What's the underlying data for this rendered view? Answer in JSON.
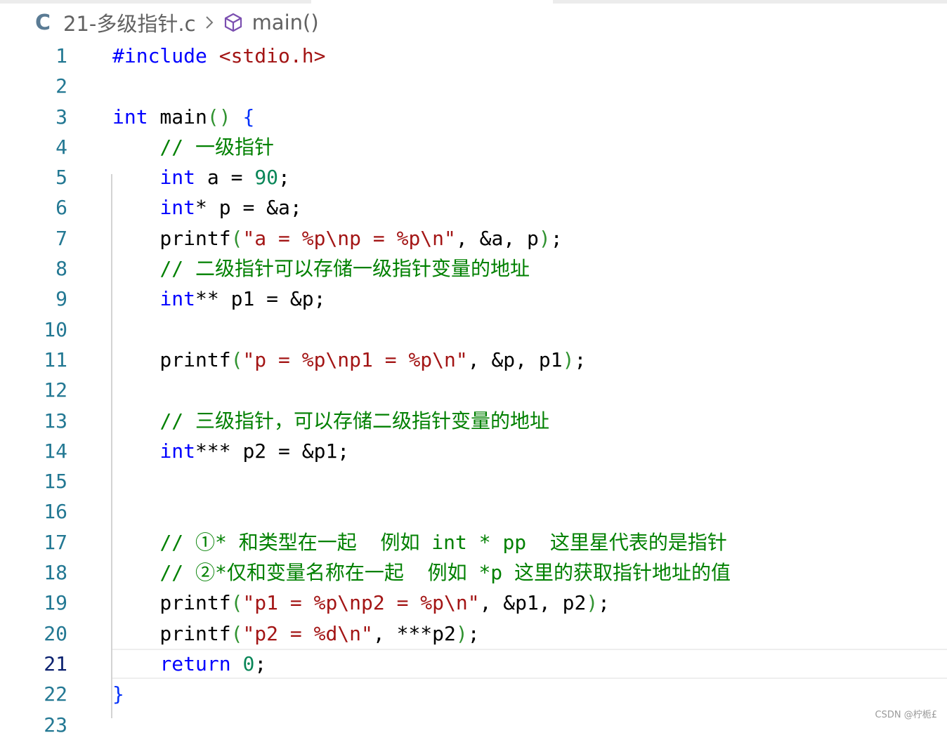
{
  "breadcrumb": {
    "lang_icon": "C",
    "file": "21-多级指针.c",
    "symbol": "main()",
    "separator_icon": "chevron-right-icon",
    "symbol_icon": "cube-icon"
  },
  "editor": {
    "active_line": 21,
    "lines": [
      {
        "n": "1",
        "tokens": [
          {
            "t": "#include ",
            "c": "kw"
          },
          {
            "t": "<stdio.h>",
            "c": "str"
          }
        ]
      },
      {
        "n": "2",
        "tokens": []
      },
      {
        "n": "3",
        "tokens": [
          {
            "t": "int",
            "c": "kw"
          },
          {
            "t": " main",
            "c": ""
          },
          {
            "t": "()",
            "c": "br2"
          },
          {
            "t": " ",
            "c": ""
          },
          {
            "t": "{",
            "c": "br1"
          }
        ]
      },
      {
        "n": "4",
        "tokens": [
          {
            "t": "    ",
            "c": ""
          },
          {
            "t": "// 一级指针",
            "c": "cm"
          }
        ]
      },
      {
        "n": "5",
        "tokens": [
          {
            "t": "    ",
            "c": ""
          },
          {
            "t": "int",
            "c": "kw"
          },
          {
            "t": " a = ",
            "c": ""
          },
          {
            "t": "90",
            "c": "num"
          },
          {
            "t": ";",
            "c": ""
          }
        ]
      },
      {
        "n": "6",
        "tokens": [
          {
            "t": "    ",
            "c": ""
          },
          {
            "t": "int",
            "c": "kw"
          },
          {
            "t": "* p = &a;",
            "c": ""
          }
        ]
      },
      {
        "n": "7",
        "tokens": [
          {
            "t": "    printf",
            "c": ""
          },
          {
            "t": "(",
            "c": "br2"
          },
          {
            "t": "\"a = %p\\np = %p\\n\"",
            "c": "str"
          },
          {
            "t": ", &a, p",
            "c": ""
          },
          {
            "t": ")",
            "c": "br2"
          },
          {
            "t": ";",
            "c": ""
          }
        ]
      },
      {
        "n": "8",
        "tokens": [
          {
            "t": "    ",
            "c": ""
          },
          {
            "t": "// 二级指针可以存储一级指针变量的地址",
            "c": "cm"
          }
        ]
      },
      {
        "n": "9",
        "tokens": [
          {
            "t": "    ",
            "c": ""
          },
          {
            "t": "int",
            "c": "kw"
          },
          {
            "t": "** p1 = &p;",
            "c": ""
          }
        ]
      },
      {
        "n": "10",
        "tokens": []
      },
      {
        "n": "11",
        "tokens": [
          {
            "t": "    printf",
            "c": ""
          },
          {
            "t": "(",
            "c": "br2"
          },
          {
            "t": "\"p = %p\\np1 = %p\\n\"",
            "c": "str"
          },
          {
            "t": ", &p, p1",
            "c": ""
          },
          {
            "t": ")",
            "c": "br2"
          },
          {
            "t": ";",
            "c": ""
          }
        ]
      },
      {
        "n": "12",
        "tokens": []
      },
      {
        "n": "13",
        "tokens": [
          {
            "t": "    ",
            "c": ""
          },
          {
            "t": "// 三级指针，可以存储二级指针变量的地址",
            "c": "cm"
          }
        ]
      },
      {
        "n": "14",
        "tokens": [
          {
            "t": "    ",
            "c": ""
          },
          {
            "t": "int",
            "c": "kw"
          },
          {
            "t": "*** p2 = &p1;",
            "c": ""
          }
        ]
      },
      {
        "n": "15",
        "tokens": []
      },
      {
        "n": "16",
        "tokens": []
      },
      {
        "n": "17",
        "tokens": [
          {
            "t": "    ",
            "c": ""
          },
          {
            "t": "// ①* 和类型在一起  例如 int * pp  这里星代表的是指针",
            "c": "cm"
          }
        ]
      },
      {
        "n": "18",
        "tokens": [
          {
            "t": "    ",
            "c": ""
          },
          {
            "t": "// ②*仅和变量名称在一起  例如 *p 这里的获取指针地址的值",
            "c": "cm"
          }
        ]
      },
      {
        "n": "19",
        "tokens": [
          {
            "t": "    printf",
            "c": ""
          },
          {
            "t": "(",
            "c": "br2"
          },
          {
            "t": "\"p1 = %p\\np2 = %p\\n\"",
            "c": "str"
          },
          {
            "t": ", &p1, p2",
            "c": ""
          },
          {
            "t": ")",
            "c": "br2"
          },
          {
            "t": ";",
            "c": ""
          }
        ]
      },
      {
        "n": "20",
        "tokens": [
          {
            "t": "    printf",
            "c": ""
          },
          {
            "t": "(",
            "c": "br2"
          },
          {
            "t": "\"p2 = %d\\n\"",
            "c": "str"
          },
          {
            "t": ", ***p2",
            "c": ""
          },
          {
            "t": ")",
            "c": "br2"
          },
          {
            "t": ";",
            "c": ""
          }
        ]
      },
      {
        "n": "21",
        "tokens": [
          {
            "t": "    ",
            "c": ""
          },
          {
            "t": "return",
            "c": "kw"
          },
          {
            "t": " ",
            "c": ""
          },
          {
            "t": "0",
            "c": "num"
          },
          {
            "t": ";",
            "c": ""
          }
        ]
      },
      {
        "n": "22",
        "tokens": [
          {
            "t": "}",
            "c": "br1"
          }
        ]
      },
      {
        "n": "23",
        "tokens": []
      }
    ]
  },
  "watermark": "CSDN @柠栀£"
}
